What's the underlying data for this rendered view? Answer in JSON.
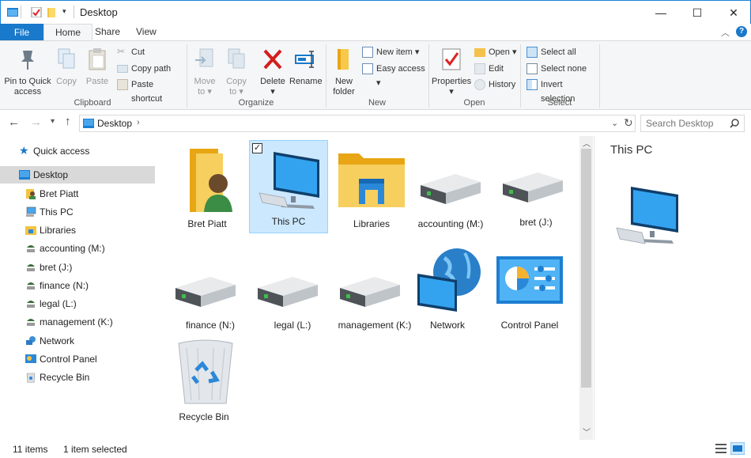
{
  "window": {
    "title": "Desktop",
    "minimize": "—",
    "maximize": "☐",
    "close": "✕"
  },
  "tabs": [
    {
      "label": "File"
    },
    {
      "label": "Home"
    },
    {
      "label": "Share"
    },
    {
      "label": "View"
    }
  ],
  "ribbon": {
    "clipboard": {
      "pin_label_1": "Pin to Quick",
      "pin_label_2": "access",
      "copy": "Copy",
      "paste": "Paste",
      "cut": "Cut",
      "copy_path": "Copy path",
      "paste_shortcut": "Paste shortcut",
      "group": "Clipboard"
    },
    "organize": {
      "move_to_1": "Move",
      "move_to_2": "to",
      "copy_to_1": "Copy",
      "copy_to_2": "to",
      "delete": "Delete",
      "rename": "Rename",
      "group": "Organize"
    },
    "new": {
      "new_folder_1": "New",
      "new_folder_2": "folder",
      "new_item": "New item",
      "easy_access": "Easy access",
      "group": "New"
    },
    "open": {
      "properties": "Properties",
      "open": "Open",
      "edit": "Edit",
      "history": "History",
      "group": "Open"
    },
    "select": {
      "select_all": "Select all",
      "select_none": "Select none",
      "invert_selection": "Invert selection",
      "group": "Select"
    }
  },
  "address": {
    "location": "Desktop",
    "search_placeholder": "Search Desktop"
  },
  "nav": {
    "quick_access": "Quick access",
    "items": [
      {
        "label": "Desktop"
      },
      {
        "label": "Bret Piatt"
      },
      {
        "label": "This PC"
      },
      {
        "label": "Libraries"
      },
      {
        "label": "accounting (M:)"
      },
      {
        "label": "bret (J:)"
      },
      {
        "label": "finance (N:)"
      },
      {
        "label": "legal (L:)"
      },
      {
        "label": "management (K:)"
      },
      {
        "label": "Network"
      },
      {
        "label": "Control Panel"
      },
      {
        "label": "Recycle Bin"
      }
    ]
  },
  "content": {
    "tiles": [
      {
        "label": "Bret Piatt"
      },
      {
        "label": "This PC"
      },
      {
        "label": "Libraries"
      },
      {
        "label": "accounting (M:)"
      },
      {
        "label": "bret (J:)"
      },
      {
        "label": "finance (N:)"
      },
      {
        "label": "legal (L:)"
      },
      {
        "label": "management (K:)"
      },
      {
        "label": "Network"
      },
      {
        "label": "Control Panel"
      },
      {
        "label": "Recycle Bin"
      }
    ]
  },
  "preview": {
    "title": "This PC"
  },
  "status": {
    "count": "11 items",
    "selected": "1 item selected"
  },
  "colors": {
    "accent": "#1979ca",
    "selection": "#cce8ff",
    "selection_border": "#99d1ff"
  }
}
